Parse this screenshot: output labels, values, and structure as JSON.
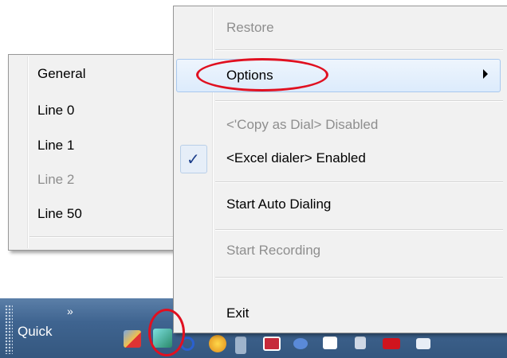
{
  "context_menu": {
    "items": [
      {
        "label": "Restore",
        "enabled": false
      },
      {
        "label": "Options",
        "enabled": true,
        "has_submenu": true,
        "highlighted": true
      },
      {
        "label": "<'Copy  as Dial>  Disabled",
        "enabled": false
      },
      {
        "label": "<Excel dialer> Enabled",
        "enabled": true,
        "checked": true
      },
      {
        "label": "Start Auto Dialing",
        "enabled": true
      },
      {
        "label": "Start Recording",
        "enabled": false
      },
      {
        "label": "Exit",
        "enabled": true
      }
    ],
    "check_glyph": "✓"
  },
  "options_submenu": {
    "items": [
      {
        "label": "General",
        "enabled": true
      },
      {
        "label": "Line 0",
        "enabled": true
      },
      {
        "label": "Line 1",
        "enabled": true
      },
      {
        "label": "Line 2",
        "enabled": false
      },
      {
        "label": "Line 50",
        "enabled": true
      }
    ]
  },
  "taskbar": {
    "quick_label": "Quick",
    "chevron": "»"
  },
  "colors": {
    "annotation": "#e01020",
    "highlight": "#dcebfc",
    "taskbar": "#3f6490"
  }
}
